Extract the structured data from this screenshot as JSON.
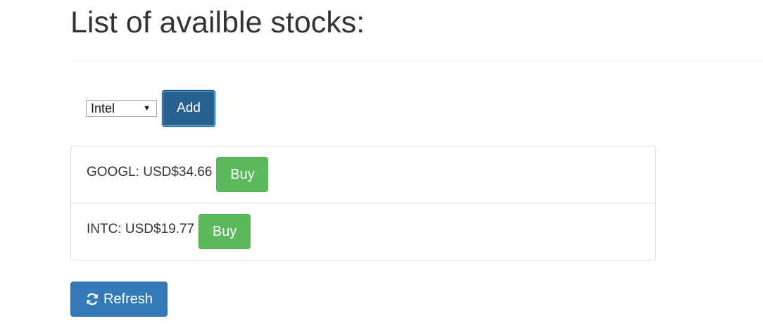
{
  "page": {
    "title": "List of availble stocks:"
  },
  "add_form": {
    "selected_stock": "Intel",
    "add_label": "Add"
  },
  "stocks": [
    {
      "text": "GOOGL: USD$34.66",
      "buy_label": "Buy"
    },
    {
      "text": "INTC: USD$19.77",
      "buy_label": "Buy"
    }
  ],
  "refresh": {
    "label": "Refresh",
    "icon": "refresh-icon"
  },
  "colors": {
    "primary": "#337ab7",
    "primary_active": "#286090",
    "success": "#5cb85c",
    "text": "#333333",
    "border": "#dddddd"
  }
}
